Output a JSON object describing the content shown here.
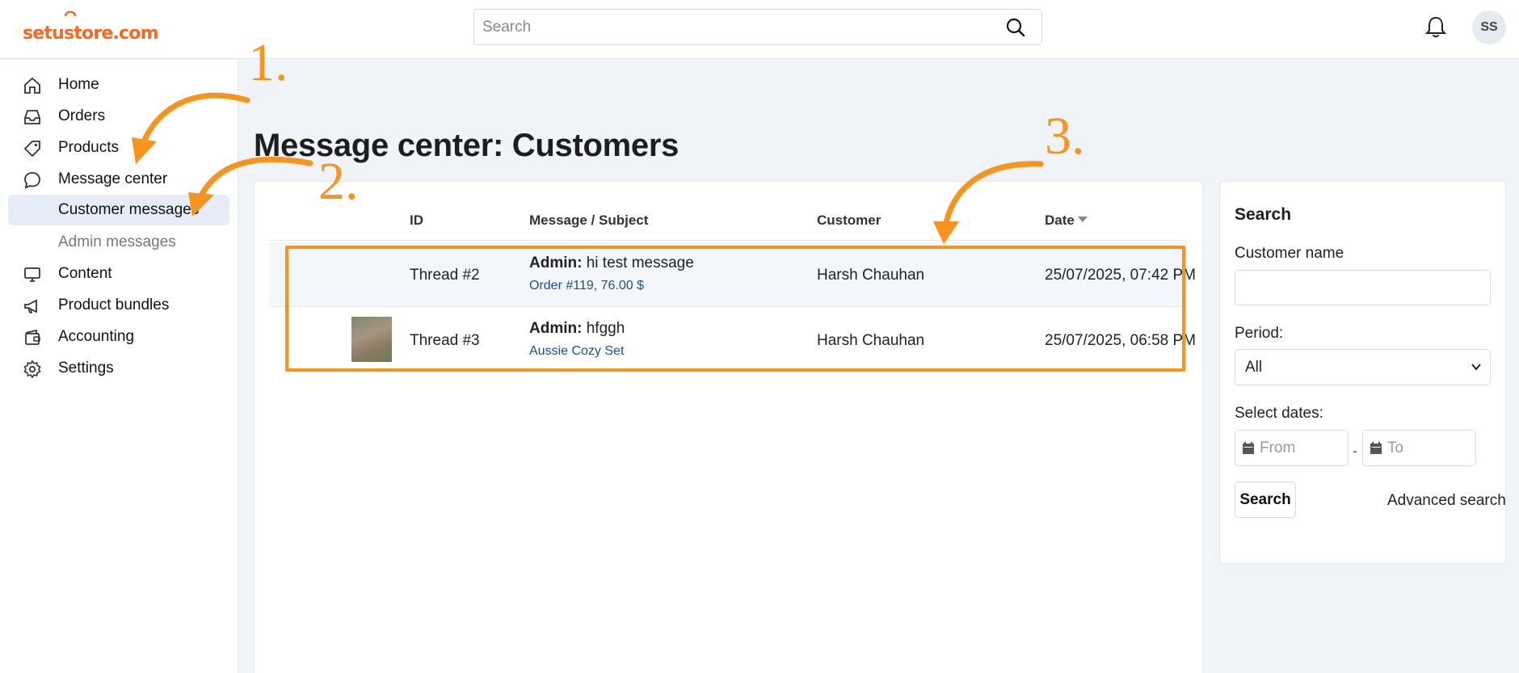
{
  "header": {
    "logo_text": "setustore.com",
    "search_placeholder": "Search",
    "avatar_initials": "SS",
    "brand_color": "#f26b21"
  },
  "sidebar": {
    "items": [
      {
        "label": "Home",
        "icon": "home-icon"
      },
      {
        "label": "Orders",
        "icon": "inbox-icon"
      },
      {
        "label": "Products",
        "icon": "tag-icon"
      },
      {
        "label": "Message center",
        "icon": "chat-bubble-icon"
      },
      {
        "label": "Customer messages",
        "icon": ""
      },
      {
        "label": "Admin messages",
        "icon": ""
      },
      {
        "label": "Content",
        "icon": "monitor-icon"
      },
      {
        "label": "Product bundles",
        "icon": "megaphone-icon"
      },
      {
        "label": "Accounting",
        "icon": "wallet-icon"
      },
      {
        "label": "Settings",
        "icon": "gear-icon"
      }
    ]
  },
  "main": {
    "title": "Message center: Customers",
    "table": {
      "headers": {
        "id": "ID",
        "subject": "Message / Subject",
        "customer": "Customer",
        "date": "Date"
      },
      "rows": [
        {
          "id": "Thread #2",
          "author": "Admin:",
          "message": "hi test message",
          "link": "Order #119, 76.00 $",
          "customer": "Harsh Chauhan",
          "date": "25/07/2025, 07:42 PM",
          "has_thumbnail": false
        },
        {
          "id": "Thread #3",
          "author": "Admin:",
          "message": "hfggh",
          "link": "Aussie Cozy Set",
          "customer": "Harsh Chauhan",
          "date": "25/07/2025, 06:58 PM",
          "has_thumbnail": true
        }
      ]
    }
  },
  "search_panel": {
    "title": "Search",
    "customer_name_label": "Customer name",
    "customer_name_value": "",
    "period_label": "Period:",
    "period_value": "All",
    "select_dates_label": "Select dates:",
    "from_placeholder": "From",
    "to_placeholder": "To",
    "search_button": "Search",
    "advanced_search": "Advanced search"
  },
  "annotations": {
    "step1": "1.",
    "step2": "2.",
    "step3": "3.",
    "color": "#f7941d"
  }
}
